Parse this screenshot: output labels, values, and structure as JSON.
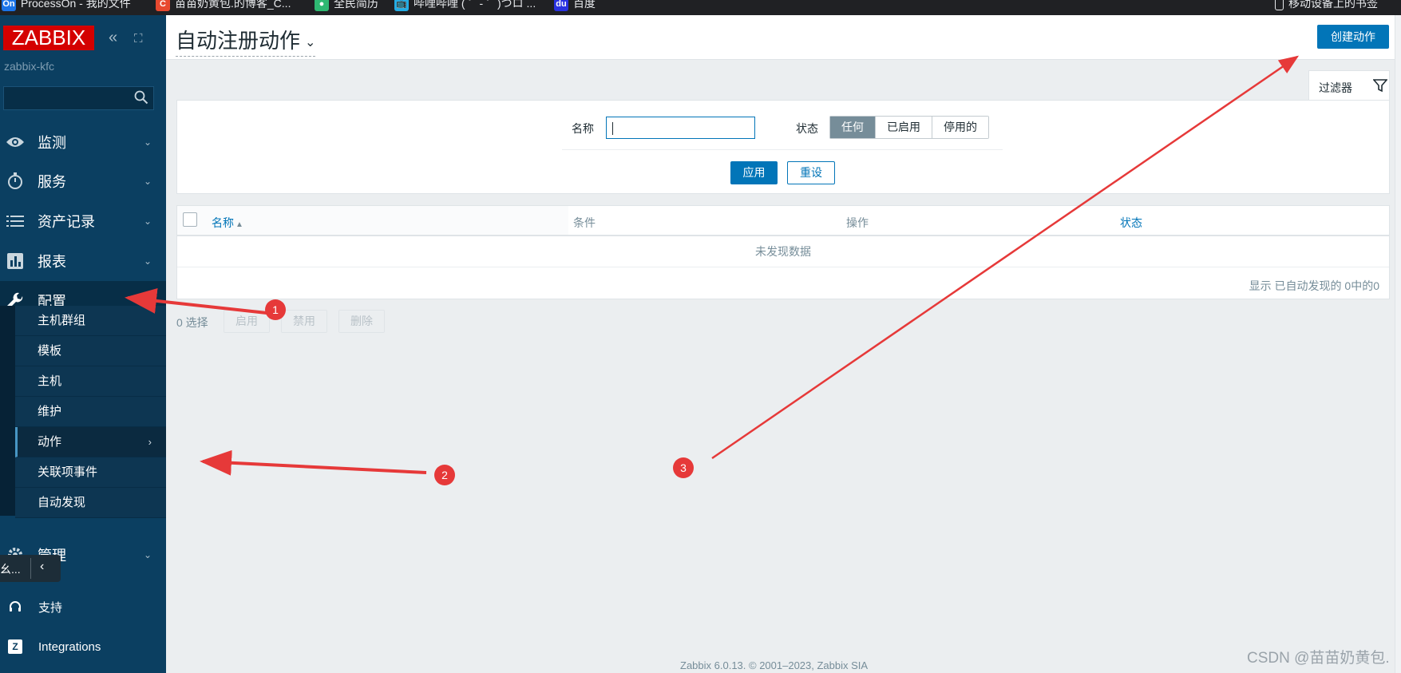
{
  "browser": {
    "bookmarks": [
      {
        "icon": "On",
        "label": "ProcessOn - 我的文件",
        "color": "#1a73e8"
      },
      {
        "icon": "C",
        "label": "苗苗奶黄包.的博客_C...",
        "color": "#e8492f"
      },
      {
        "icon": "●",
        "label": "全民简历",
        "color": "#2eb872"
      },
      {
        "icon": "📺",
        "label": "哔哩哔哩 ( ゜- ゜)つロ ...",
        "color": "#23ade5"
      },
      {
        "icon": "du",
        "label": "百度",
        "color": "#2932e1"
      }
    ],
    "mobile_bookmarks": "移动设备上的书签"
  },
  "sidebar": {
    "logo": "ZABBIX",
    "server_name": "zabbix-kfc",
    "search_placeholder": "",
    "menu": [
      {
        "label": "监测",
        "icon": "eye-icon"
      },
      {
        "label": "服务",
        "icon": "stopwatch-icon"
      },
      {
        "label": "资产记录",
        "icon": "list-icon"
      },
      {
        "label": "报表",
        "icon": "bar-chart-icon"
      },
      {
        "label": "配置",
        "icon": "wrench-icon"
      }
    ],
    "submenu": [
      "主机群组",
      "模板",
      "主机",
      "维护",
      "动作",
      "关联项事件",
      "自动发现"
    ],
    "admin_label": "管理",
    "tooltip_text": "幺...",
    "bottom": [
      {
        "label": "支持",
        "icon": "headset-icon"
      },
      {
        "label": "Integrations",
        "icon": "zabbix-z-icon"
      }
    ]
  },
  "header": {
    "title": "自动注册动作",
    "create_button": "创建动作"
  },
  "filter": {
    "tab_label": "过滤器",
    "name_label": "名称",
    "name_value": "",
    "status_label": "状态",
    "status_options": [
      "任何",
      "已启用",
      "停用的"
    ],
    "status_selected": "任何",
    "apply": "应用",
    "reset": "重设"
  },
  "table": {
    "columns": [
      "名称",
      "条件",
      "操作",
      "状态"
    ],
    "sort_indicator": "▲",
    "empty_text": "未发现数据",
    "footer": "显示 已自动发现的 0中的0"
  },
  "mass_actions": {
    "selected": "0 选择",
    "enable": "启用",
    "disable": "禁用",
    "delete": "删除"
  },
  "annotations": [
    "1",
    "2",
    "3"
  ],
  "page_footer": "Zabbix 6.0.13. © 2001–2023, Zabbix SIA",
  "watermark": "CSDN @苗苗奶黄包."
}
